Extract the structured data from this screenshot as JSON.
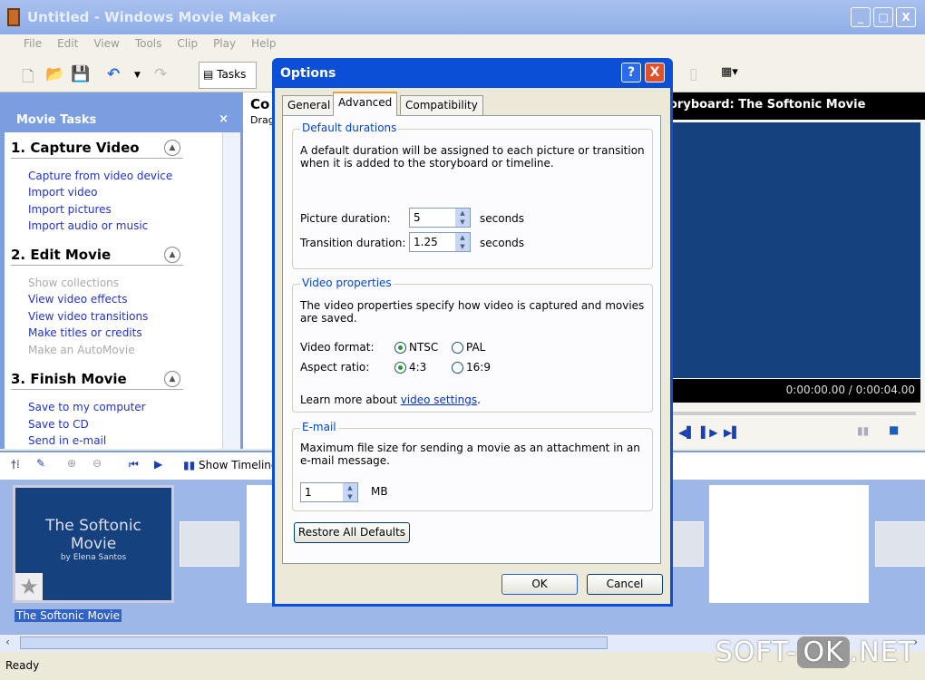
{
  "window": {
    "title": "Untitled - Windows Movie Maker",
    "min": "_",
    "max": "□",
    "close": "X"
  },
  "menu": [
    "File",
    "Edit",
    "View",
    "Tools",
    "Clip",
    "Play",
    "Help"
  ],
  "toolbar": {
    "tasks_label": "Tasks"
  },
  "task_pane": {
    "title": "Movie Tasks",
    "close": "×",
    "sections": [
      {
        "title": "1. Capture Video",
        "links": [
          {
            "label": "Capture from video device",
            "enabled": true
          },
          {
            "label": "Import video",
            "enabled": true
          },
          {
            "label": "Import pictures",
            "enabled": true
          },
          {
            "label": "Import audio or music",
            "enabled": true
          }
        ]
      },
      {
        "title": "2. Edit Movie",
        "links": [
          {
            "label": "Show collections",
            "enabled": false
          },
          {
            "label": "View video effects",
            "enabled": true
          },
          {
            "label": "View video transitions",
            "enabled": true
          },
          {
            "label": "Make titles or credits",
            "enabled": true
          },
          {
            "label": "Make an AutoMovie",
            "enabled": false
          }
        ]
      },
      {
        "title": "3. Finish Movie",
        "links": [
          {
            "label": "Save to my computer",
            "enabled": true
          },
          {
            "label": "Save to CD",
            "enabled": true
          },
          {
            "label": "Send in e-mail",
            "enabled": true
          }
        ]
      }
    ]
  },
  "middle": {
    "title": "Co",
    "sub": "Drag"
  },
  "preview": {
    "title": "oryboard: The Softonic Movie",
    "time": "0:00:00.00 / 0:00:04.00"
  },
  "storyboard_toolbar": {
    "show_timeline": "Show Timeline"
  },
  "storyboard": {
    "clip_title": "The Softonic",
    "clip_title2": "Movie",
    "clip_by": "by Elena Santos",
    "clip_label": "The Softonic Movie"
  },
  "status": "Ready",
  "dialog": {
    "title": "Options",
    "help": "?",
    "close": "X",
    "tabs": [
      "General",
      "Advanced",
      "Compatibility"
    ],
    "active_tab": "Advanced",
    "default_durations": {
      "title": "Default durations",
      "desc": "A default duration will be assigned to each picture or transition when it is added to the storyboard or timeline.",
      "picture_label": "Picture duration:",
      "picture_value": "5",
      "transition_label": "Transition duration:",
      "transition_value": "1.25",
      "unit": "seconds"
    },
    "video_properties": {
      "title": "Video properties",
      "desc": "The video properties specify how video is captured and movies are saved.",
      "format_label": "Video format:",
      "format_options": [
        "NTSC",
        "PAL"
      ],
      "format_selected": "NTSC",
      "aspect_label": "Aspect ratio:",
      "aspect_options": [
        "4:3",
        "16:9"
      ],
      "aspect_selected": "4:3",
      "learn_prefix": "Learn more about ",
      "learn_link": "video settings",
      "learn_suffix": "."
    },
    "email": {
      "title": "E-mail",
      "desc": "Maximum file size for sending a movie as an attachment in an e-mail message.",
      "value": "1",
      "unit": "MB"
    },
    "restore": "Restore All Defaults",
    "ok": "OK",
    "cancel": "Cancel"
  },
  "watermark": {
    "a": "SOFT-",
    "b": "OK",
    ".c": "",
    "c": ".NET"
  }
}
